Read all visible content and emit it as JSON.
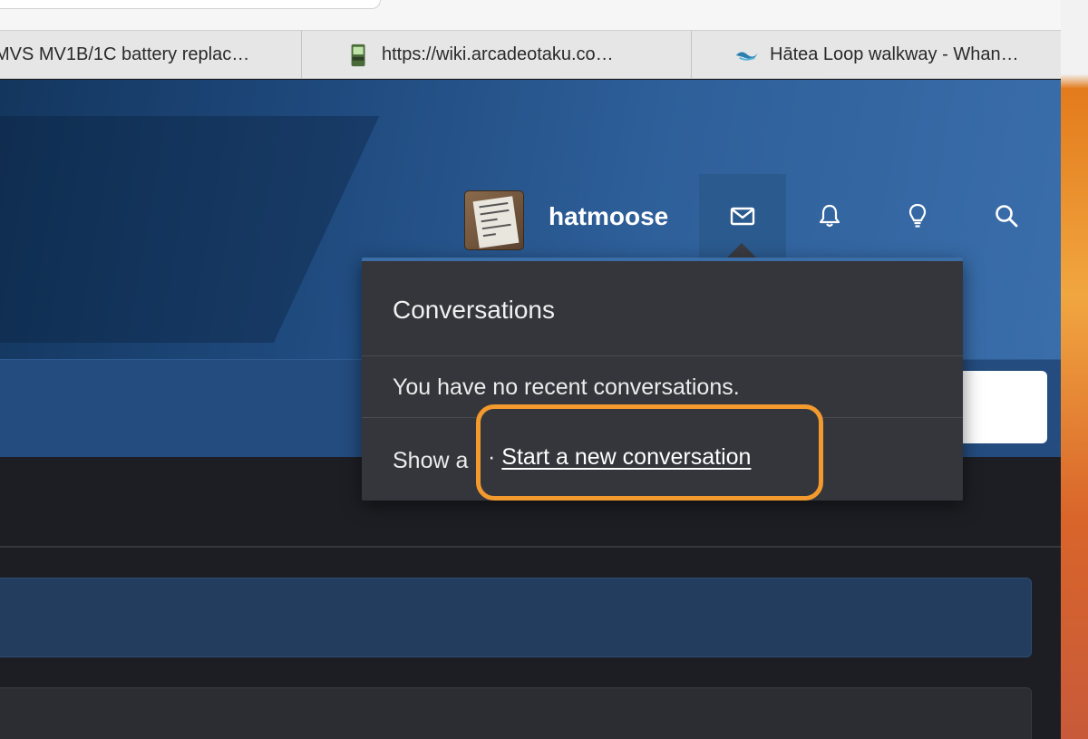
{
  "browser": {
    "tabs": [
      {
        "label": "MVS MV1B/1C battery replac…",
        "icon": "page-icon"
      },
      {
        "label": "https://wiki.arcadeotaku.co…",
        "icon": "arcade-cabinet-icon"
      },
      {
        "label": "Hātea Loop walkway - Whan…",
        "icon": "wave-icon"
      }
    ]
  },
  "header": {
    "username": "hatmoose",
    "icons": [
      "envelope-icon",
      "bell-icon",
      "lightbulb-icon",
      "search-icon"
    ]
  },
  "conversations_menu": {
    "title": "Conversations",
    "empty_message": "You have no recent conversations.",
    "show_all_label": "Show a",
    "separator": "·",
    "start_new_label": "Start a new conversation"
  },
  "colors": {
    "highlight": "#f29a2e",
    "header_blue": "#2e5f99",
    "menu_bg": "#35363c"
  }
}
